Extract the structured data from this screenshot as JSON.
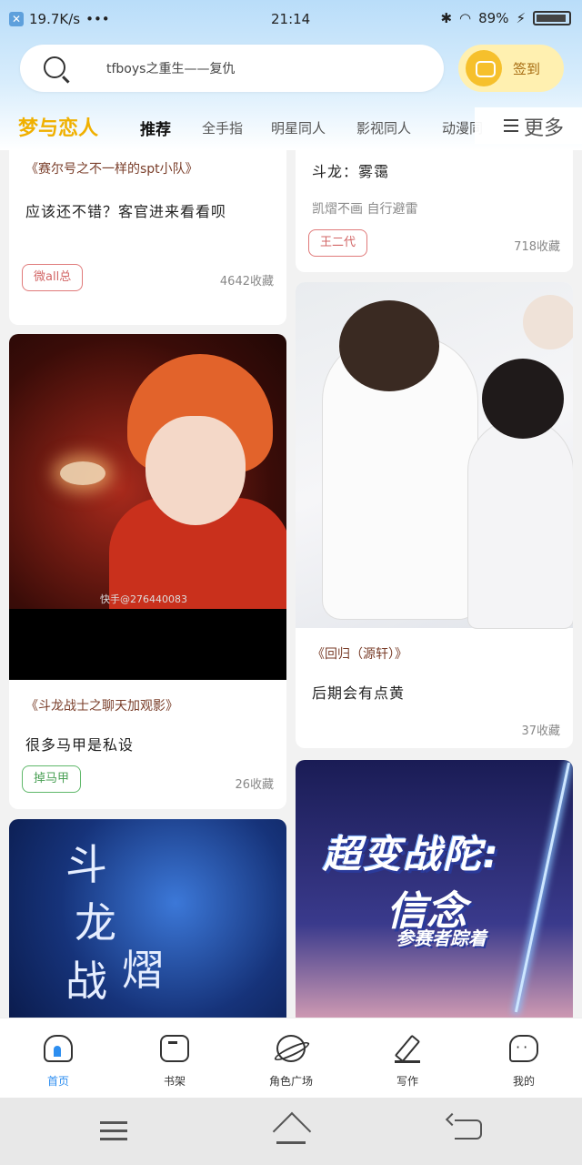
{
  "status_bar": {
    "net_speed": "19.7K/s",
    "dots": "•••",
    "time": "21:14",
    "battery": "89%"
  },
  "search": {
    "placeholder": "tfboys之重生——复仇"
  },
  "signin": {
    "label": "签到"
  },
  "tabs": {
    "brand": "梦与恋人",
    "items": [
      "推荐",
      "全手指",
      "明星同人",
      "影视同人",
      "动漫同"
    ],
    "more": "更多"
  },
  "feed": [
    {
      "title": "《赛尔号之不一样的spt小队》",
      "desc": "应该还不错？客官进来看看呗",
      "tag": "微all总",
      "fav": "4642收藏"
    },
    {
      "title": "斗龙：雾霭",
      "sub": "凯熠不画  自行避雷",
      "tag": "王二代",
      "fav": "718收藏"
    },
    {
      "watermark": "快手@276440083",
      "title": "《斗龙战士之聊天加观影》",
      "desc": "很多马甲是私设",
      "tag": "掉马甲",
      "fav": "26收藏"
    },
    {
      "title": "《回归（源轩）》",
      "desc": "后期会有点黄",
      "fav": "37收藏"
    },
    {
      "cover_chars": [
        "斗",
        "龙",
        "战",
        "熠"
      ]
    },
    {
      "cover_title_1": "超变战陀:",
      "cover_title_2": "信念",
      "cover_sub": "参赛者踪着"
    }
  ],
  "bottom_nav": [
    {
      "label": "首页",
      "icon": "home-icon"
    },
    {
      "label": "书架",
      "icon": "bookshelf-icon"
    },
    {
      "label": "角色广场",
      "icon": "planet-icon"
    },
    {
      "label": "写作",
      "icon": "pen-icon"
    },
    {
      "label": "我的",
      "icon": "chat-icon"
    }
  ],
  "colors": {
    "accent": "#2d8ef0",
    "brand": "#f0b000",
    "tag_red": "#d26666",
    "tag_green": "#4aa055"
  }
}
